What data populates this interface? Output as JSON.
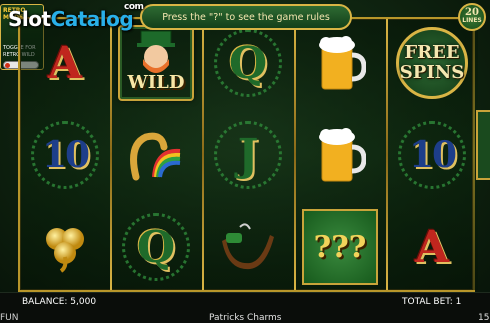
{
  "header": {
    "logo_main": "Slot",
    "logo_accent": "Catalog",
    "logo_suffix": "com",
    "hint": "Press the \"?\" to see the game rules",
    "lines_count": "20",
    "lines_label": "LINES"
  },
  "retro_panel": {
    "title": "RETRO MODE",
    "description": "TOGGLE FOR RETRO WILD"
  },
  "reels": {
    "symbols": [
      [
        "A",
        "10",
        "clover"
      ],
      [
        "wild",
        "horseshoe",
        "Q"
      ],
      [
        "Q",
        "J",
        "pipe"
      ],
      [
        "beer",
        "beer",
        "mystery"
      ],
      [
        "free-spins",
        "10",
        "A"
      ]
    ],
    "wild_label": "WILD",
    "free_spins_label": "FREE SPINS",
    "mystery_label": "???"
  },
  "footer": {
    "balance": "BALANCE: 5,000",
    "total_bet": "TOTAL BET: 1",
    "mode": "FUN",
    "game_name": "Patricks Charms",
    "right_value": "15"
  },
  "colors": {
    "gold": "#d9b545",
    "green_dark": "#0f2410",
    "red_A": "#c0261e",
    "blue_10": "#1d3e8a"
  }
}
